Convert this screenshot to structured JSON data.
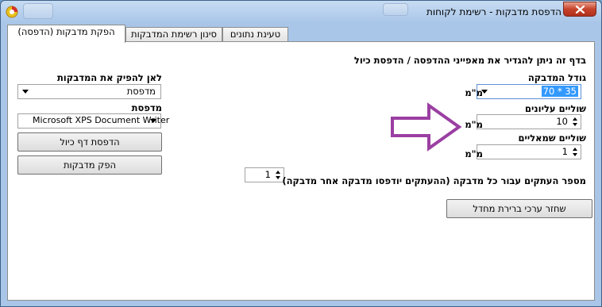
{
  "window": {
    "title": "הדפסת מדבקות - רשימת לקוחות"
  },
  "tabs": [
    {
      "label": "הפקת מדבקות (הדפסה)",
      "active": true
    },
    {
      "label": "סינון רשימת המדבקות",
      "active": false
    },
    {
      "label": "טעינת נתונים",
      "active": false
    }
  ],
  "content": {
    "intro": "בדף זה ניתן להגדיר את מאפייני ההדפסה / הדפסת כיול",
    "label_size": {
      "label": "גודל המדבקה",
      "value": "70 * 35",
      "unit": "מ\"מ"
    },
    "top_margin": {
      "label": "שוליים עליונים",
      "value": "10",
      "unit": "מ\"מ"
    },
    "left_margin": {
      "label": "שוליים שמאליים",
      "value": "1",
      "unit": "מ\"מ"
    },
    "copies": {
      "label": "מספר העתקים עבור כל מדבקה (ההעתקים יודפסו מדבקה אחר מדבקה)",
      "value": "1"
    },
    "restore_defaults_button": "שחזר ערכי ברירת מחדל",
    "output_target": {
      "label": "לאן להפיק את המדבקות",
      "value": "מדפסת"
    },
    "printer": {
      "label": "מדפסת",
      "value": "Microsoft XPS Document Writer"
    },
    "print_calibration_button": "הדפסת דף כיול",
    "produce_labels_button": "הפק מדבקות"
  },
  "colors": {
    "annotation_arrow": "#9b3fa2",
    "selection": "#3399ff",
    "close_button": "#c7432b"
  }
}
